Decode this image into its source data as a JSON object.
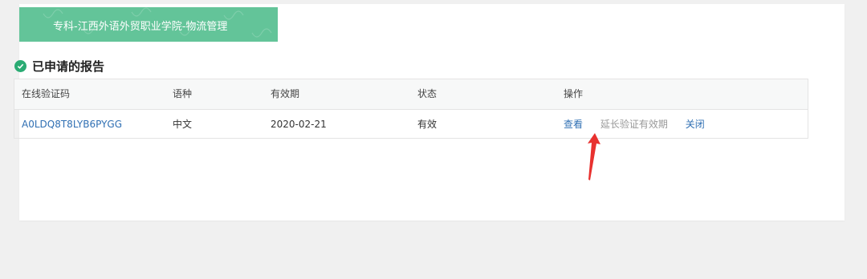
{
  "banner": {
    "text": "专科-江西外语外贸职业学院-物流管理"
  },
  "section": {
    "title": "已申请的报告"
  },
  "table": {
    "headers": [
      "在线验证码",
      "语种",
      "有效期",
      "状态",
      "操作"
    ],
    "rows": [
      {
        "code": "A0LDQ8T8LYB6PYGG",
        "language": "中文",
        "expiry": "2020-02-21",
        "status": "有效",
        "actions": {
          "view": "查看",
          "extend": "延长验证有效期",
          "close": "关闭"
        }
      }
    ]
  },
  "colors": {
    "banner": "#63c499",
    "link": "#2f6fb3",
    "check": "#2aab73",
    "arrow": "#e8312f"
  },
  "icons": {
    "section": "check-circle-icon",
    "annotation": "red-arrow-icon"
  }
}
